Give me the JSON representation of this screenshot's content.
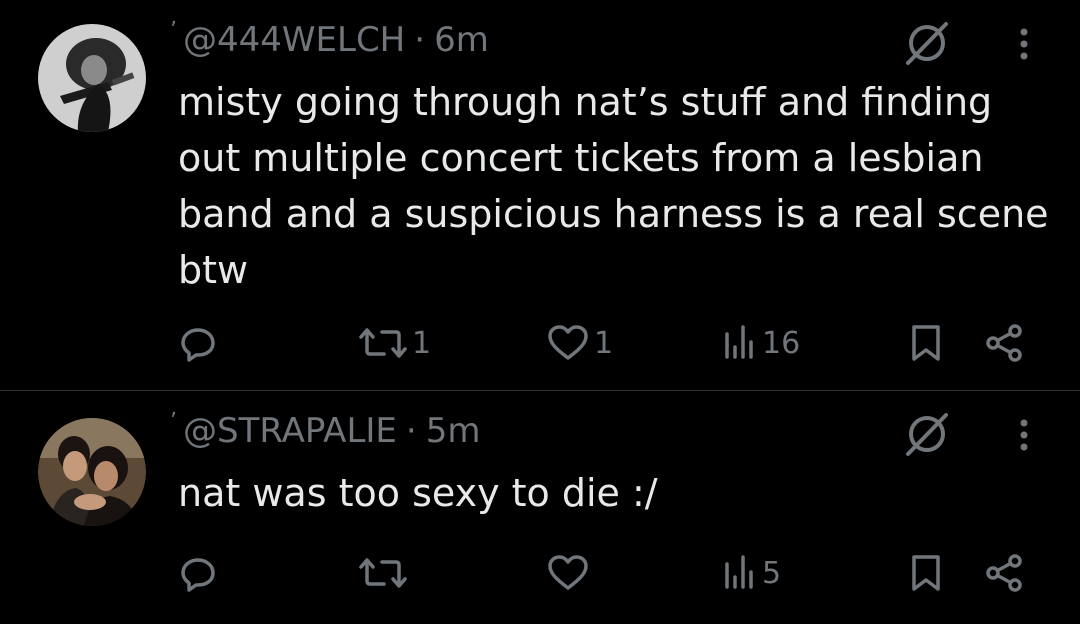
{
  "tweets": [
    {
      "handle": "@444WELCH",
      "separator": "·",
      "time": "6m",
      "text": "misty going through nat’s stuff and finding out multiple concert tickets from a lesbian band and a suspicious harness is a real scene btw",
      "replies": "",
      "retweets": "1",
      "likes": "1",
      "views": "16"
    },
    {
      "handle": "@STRAPALIE",
      "separator": "·",
      "time": "5m",
      "text": "nat was too sexy to die :/",
      "replies": "",
      "retweets": "",
      "likes": "",
      "views": "5"
    }
  ],
  "colors": {
    "background": "#000000",
    "text": "#e7e9ea",
    "secondary": "#71767b",
    "divider": "#2f3336"
  }
}
